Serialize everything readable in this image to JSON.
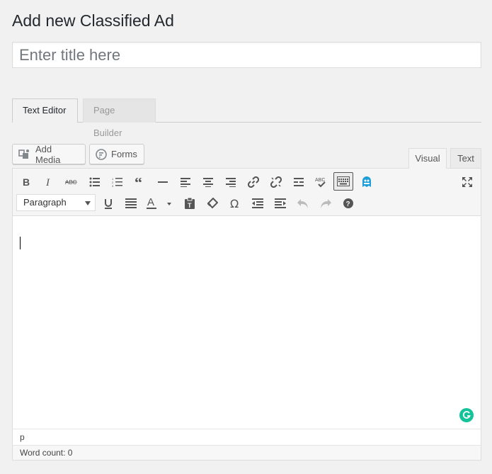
{
  "page": {
    "title": "Add new Classified Ad"
  },
  "title_input": {
    "placeholder": "Enter title here",
    "value": ""
  },
  "builder_tabs": [
    {
      "label": "Text Editor",
      "active": true
    },
    {
      "label": "Page Builder",
      "active": false
    }
  ],
  "media_buttons": {
    "add_media": "Add Media",
    "forms": "Forms"
  },
  "editor_tabs": {
    "visual": "Visual",
    "text": "Text",
    "active": "Visual"
  },
  "toolbar": {
    "row1": [
      "bold-icon",
      "italic-icon",
      "strikethrough-icon",
      "bullet-list-icon",
      "numbered-list-icon",
      "blockquote-icon",
      "horizontal-rule-icon",
      "align-left-icon",
      "align-center-icon",
      "align-right-icon",
      "link-icon",
      "unlink-icon",
      "read-more-icon",
      "spellcheck-icon",
      "toolbar-toggle-icon",
      "ghost-plugin-icon"
    ],
    "row1_right": "fullscreen-icon",
    "format_select": "Paragraph",
    "row2": [
      "underline-icon",
      "justify-icon",
      "text-color-icon",
      "paste-text-icon",
      "clear-formatting-icon",
      "special-character-icon",
      "outdent-icon",
      "indent-icon",
      "undo-icon",
      "redo-icon",
      "help-icon"
    ]
  },
  "editor": {
    "content": ""
  },
  "statusbar": {
    "path": "p"
  },
  "word_count": {
    "text": "Word count: 0"
  },
  "colors": {
    "accent": "#15c39a",
    "background": "#f1f1f1"
  }
}
